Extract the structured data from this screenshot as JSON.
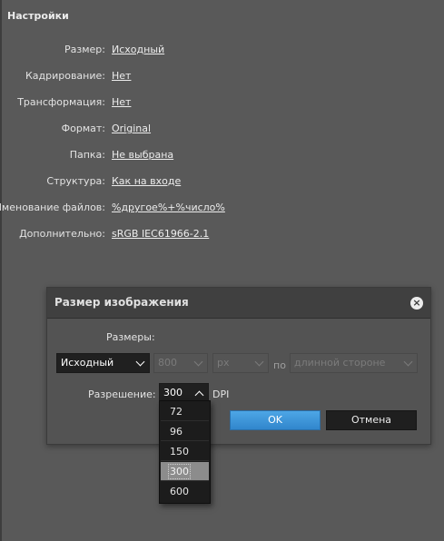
{
  "settings": {
    "title": "Настройки",
    "rows": [
      {
        "label": "Размер:",
        "value": "Исходный"
      },
      {
        "label": "Кадрирование:",
        "value": "Нет"
      },
      {
        "label": "Трансформация:",
        "value": "Нет"
      },
      {
        "label": "Формат:",
        "value": "Original"
      },
      {
        "label": "Папка:",
        "value": "Не выбрана"
      },
      {
        "label": "Структура:",
        "value": "Как на входе"
      },
      {
        "label": "Именование файлов:",
        "value": "%другое%+%число%"
      },
      {
        "label": "Дополнительно:",
        "value": "sRGB IEC61966-2.1"
      }
    ]
  },
  "dialog": {
    "title": "Размер изображения",
    "close_icon": "close-icon",
    "sizes_label": "Размеры:",
    "size_mode": "Исходный",
    "size_value": "800",
    "unit": "px",
    "by_label": "по",
    "side": "длинной стороне",
    "resolution_label": "Разрешение:",
    "resolution_value": "300",
    "dpi_label": "DPI",
    "ok_label": "OK",
    "cancel_label": "Отмена"
  },
  "resolution_options": [
    "72",
    "96",
    "150",
    "300",
    "600"
  ],
  "resolution_selected": "300",
  "colors": {
    "background": "#595959",
    "dialog_header": "#404040",
    "ok_button": "#3a93d8",
    "dropdown_bg": "#1c1c1c",
    "dropdown_selected": "#8c8c8c"
  }
}
